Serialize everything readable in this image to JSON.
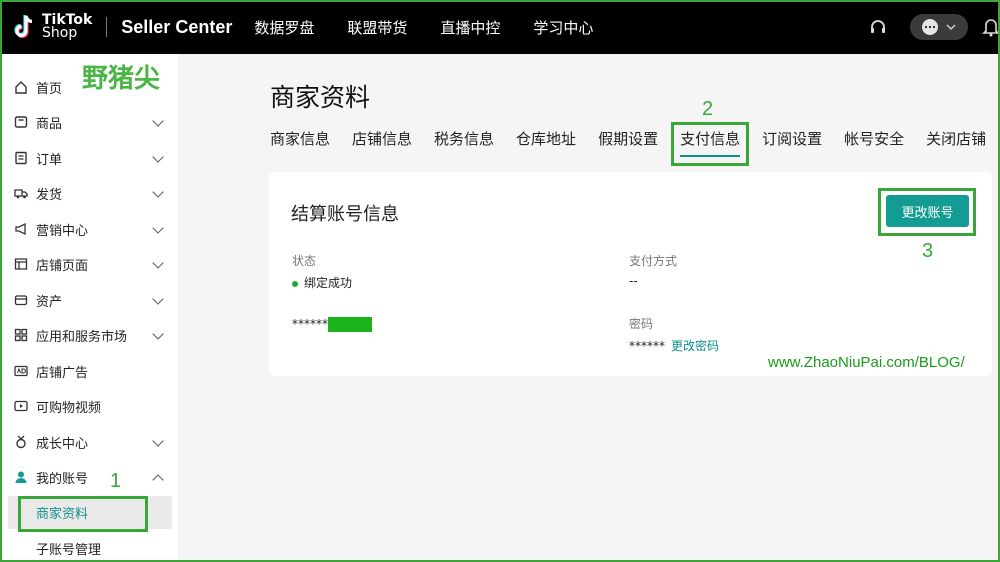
{
  "header": {
    "logo_line1": "TikTok",
    "logo_line2": "Shop",
    "title": "Seller Center",
    "nav": [
      "数据罗盘",
      "联盟带货",
      "直播中控",
      "学习中心"
    ]
  },
  "watermarks": {
    "top_left": "野猪尖",
    "url": "www.ZhaoNiuPai.com/BLOG/"
  },
  "step_markers": {
    "one": "1",
    "two": "2",
    "three": "3"
  },
  "sidebar": {
    "items": [
      {
        "label": "首页",
        "icon": "home-icon",
        "chevron": false
      },
      {
        "label": "商品",
        "icon": "product-icon",
        "chevron": true
      },
      {
        "label": "订单",
        "icon": "order-icon",
        "chevron": true
      },
      {
        "label": "发货",
        "icon": "truck-icon",
        "chevron": true
      },
      {
        "label": "营销中心",
        "icon": "megaphone-icon",
        "chevron": true
      },
      {
        "label": "店铺页面",
        "icon": "store-icon",
        "chevron": true
      },
      {
        "label": "资产",
        "icon": "wallet-icon",
        "chevron": true
      },
      {
        "label": "应用和服务市场",
        "icon": "apps-icon",
        "chevron": true
      },
      {
        "label": "店铺广告",
        "icon": "ad-icon",
        "chevron": false
      },
      {
        "label": "可购物视频",
        "icon": "video-icon",
        "chevron": false
      },
      {
        "label": "成长中心",
        "icon": "medal-icon",
        "chevron": true
      },
      {
        "label": "我的账号",
        "icon": "user-icon",
        "chevron": true
      }
    ],
    "sub_items": [
      "商家资料",
      "子账号管理"
    ]
  },
  "main": {
    "title": "商家资料",
    "tabs": [
      "商家信息",
      "店铺信息",
      "税务信息",
      "仓库地址",
      "假期设置",
      "支付信息",
      "订阅设置",
      "帐号安全",
      "关闭店铺"
    ],
    "active_tab": "支付信息"
  },
  "card": {
    "title": "结算账号信息",
    "change_button": "更改账号",
    "status_label": "状态",
    "status_value": "绑定成功",
    "payment_method_label": "支付方式",
    "payment_method_value": "--",
    "account_masked": "******",
    "password_label": "密码",
    "password_masked": "******",
    "change_password_link": "更改密码"
  },
  "colors": {
    "accent": "#129c94",
    "annotation": "#3aa63a",
    "status_ok": "#21a63b"
  }
}
